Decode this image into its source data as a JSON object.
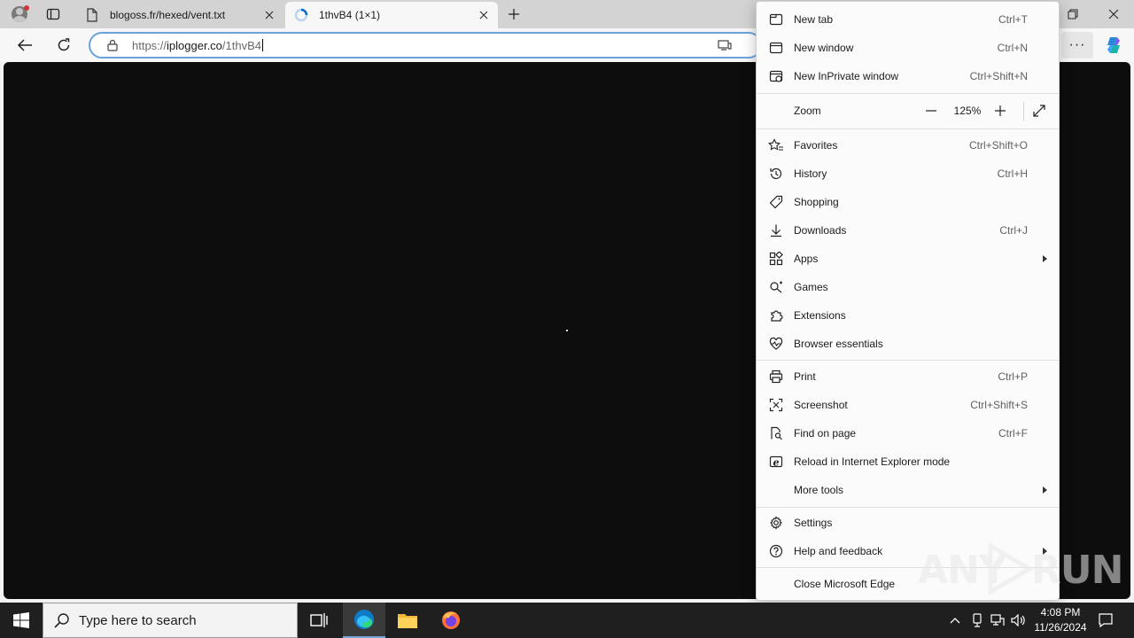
{
  "tabs": [
    {
      "title": "blogoss.fr/hexed/vent.txt",
      "active": false
    },
    {
      "title": "1thvB4 (1×1)",
      "active": true
    }
  ],
  "address": {
    "scheme": "https://",
    "domain": "iplogger.co",
    "path": "/1thvB4"
  },
  "menu": {
    "items": [
      {
        "label": "New tab",
        "shortcut": "Ctrl+T",
        "icon": "new-tab-icon"
      },
      {
        "label": "New window",
        "shortcut": "Ctrl+N",
        "icon": "new-window-icon"
      },
      {
        "label": "New InPrivate window",
        "shortcut": "Ctrl+Shift+N",
        "icon": "inprivate-icon"
      },
      {
        "label": "Favorites",
        "shortcut": "Ctrl+Shift+O",
        "icon": "favorites-icon"
      },
      {
        "label": "History",
        "shortcut": "Ctrl+H",
        "icon": "history-icon"
      },
      {
        "label": "Shopping",
        "shortcut": "",
        "icon": "tag-icon"
      },
      {
        "label": "Downloads",
        "shortcut": "Ctrl+J",
        "icon": "download-icon"
      },
      {
        "label": "Apps",
        "shortcut": "",
        "icon": "apps-icon",
        "submenu": true
      },
      {
        "label": "Games",
        "shortcut": "",
        "icon": "games-icon"
      },
      {
        "label": "Extensions",
        "shortcut": "",
        "icon": "extensions-icon"
      },
      {
        "label": "Browser essentials",
        "shortcut": "",
        "icon": "heart-pulse-icon"
      },
      {
        "label": "Print",
        "shortcut": "Ctrl+P",
        "icon": "print-icon"
      },
      {
        "label": "Screenshot",
        "shortcut": "Ctrl+Shift+S",
        "icon": "screenshot-icon"
      },
      {
        "label": "Find on page",
        "shortcut": "Ctrl+F",
        "icon": "find-icon"
      },
      {
        "label": "Reload in Internet Explorer mode",
        "shortcut": "",
        "icon": "ie-icon"
      },
      {
        "label": "More tools",
        "shortcut": "",
        "icon": "",
        "submenu": true
      },
      {
        "label": "Settings",
        "shortcut": "",
        "icon": "gear-icon"
      },
      {
        "label": "Help and feedback",
        "shortcut": "",
        "icon": "help-icon",
        "submenu": true
      },
      {
        "label": "Close Microsoft Edge",
        "shortcut": "",
        "icon": ""
      }
    ],
    "zoom": {
      "label": "Zoom",
      "value": "125%"
    }
  },
  "watermark": {
    "text_left": "ANY",
    "text_right": "RUN"
  },
  "taskbar": {
    "search_placeholder": "Type here to search",
    "time": "4:08 PM",
    "date": "11/26/2024"
  },
  "colors": {
    "content_bg": "#0d0d0d",
    "taskbar_bg": "#1f1f1f",
    "address_border": "#6aa3dc",
    "profile_badge": "#d13438"
  }
}
